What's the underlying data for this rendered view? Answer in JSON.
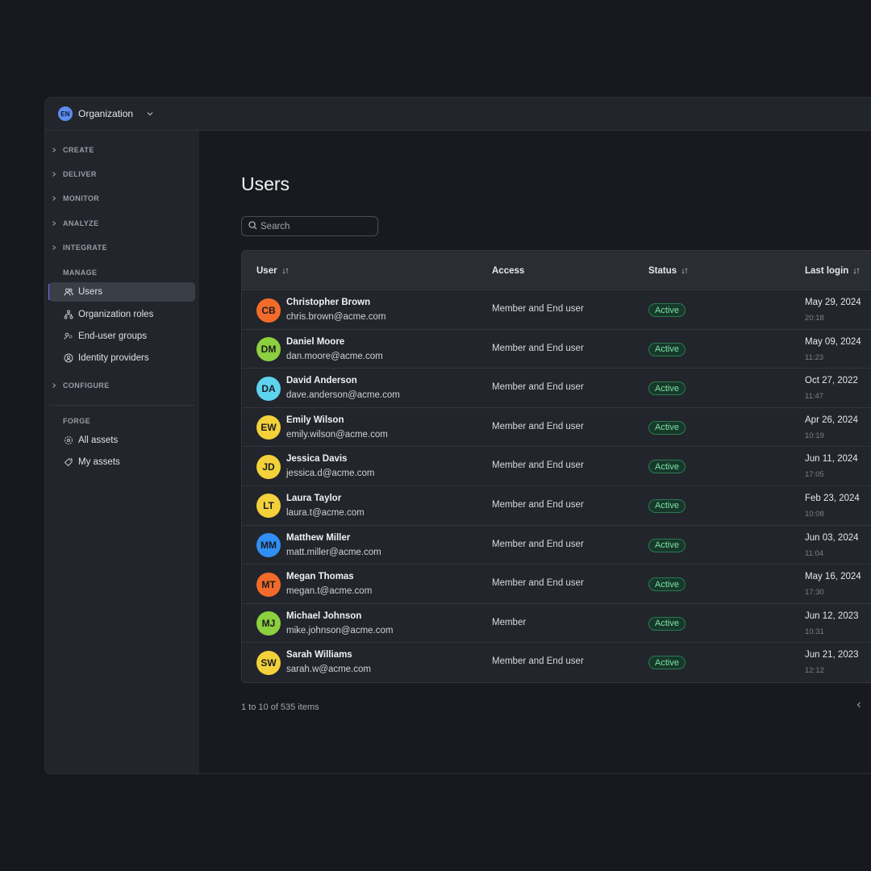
{
  "org": {
    "initials": "EN",
    "name": "Organization"
  },
  "sidebar": {
    "sections": [
      {
        "label": "CREATE"
      },
      {
        "label": "DELIVER"
      },
      {
        "label": "MONITOR"
      },
      {
        "label": "ANALYZE"
      },
      {
        "label": "INTEGRATE"
      }
    ],
    "manage_label": "MANAGE",
    "manage_items": [
      {
        "label": "Users",
        "icon": "users-icon",
        "active": true
      },
      {
        "label": "Organization roles",
        "icon": "hierarchy-icon"
      },
      {
        "label": "End-user groups",
        "icon": "user-group-icon"
      },
      {
        "label": "Identity providers",
        "icon": "identity-icon"
      }
    ],
    "configure_label": "CONFIGURE",
    "forge_label": "FORGE",
    "forge_items": [
      {
        "label": "All assets",
        "icon": "assets-icon"
      },
      {
        "label": "My assets",
        "icon": "tag-icon"
      }
    ]
  },
  "main": {
    "title": "Users",
    "search_placeholder": "Search",
    "columns": {
      "user": "User",
      "access": "Access",
      "status": "Status",
      "last_login": "Last login"
    },
    "rows": [
      {
        "initials": "CB",
        "color": "#f26b2a",
        "name": "Christopher Brown",
        "email": "chris.brown@acme.com",
        "access": "Member and End user",
        "status": "Active",
        "date": "May 29, 2024",
        "time": "20:18"
      },
      {
        "initials": "DM",
        "color": "#8ccf3f",
        "name": "Daniel Moore",
        "email": "dan.moore@acme.com",
        "access": "Member and End user",
        "status": "Active",
        "date": "May 09, 2024",
        "time": "11:23"
      },
      {
        "initials": "DA",
        "color": "#5ed3ee",
        "name": "David Anderson",
        "email": "dave.anderson@acme.com",
        "access": "Member and End user",
        "status": "Active",
        "date": "Oct 27, 2022",
        "time": "11:47"
      },
      {
        "initials": "EW",
        "color": "#f2d13a",
        "name": "Emily Wilson",
        "email": "emily.wilson@acme.com",
        "access": "Member and End user",
        "status": "Active",
        "date": "Apr 26, 2024",
        "time": "10:19"
      },
      {
        "initials": "JD",
        "color": "#f2d13a",
        "name": "Jessica Davis",
        "email": "jessica.d@acme.com",
        "access": "Member and End user",
        "status": "Active",
        "date": "Jun 11, 2024",
        "time": "17:05"
      },
      {
        "initials": "LT",
        "color": "#f2d13a",
        "name": "Laura Taylor",
        "email": "laura.t@acme.com",
        "access": "Member and End user",
        "status": "Active",
        "date": "Feb 23, 2024",
        "time": "10:08"
      },
      {
        "initials": "MM",
        "color": "#2f8ff5",
        "name": "Matthew Miller",
        "email": "matt.miller@acme.com",
        "access": "Member and End user",
        "status": "Active",
        "date": "Jun 03, 2024",
        "time": "11:04"
      },
      {
        "initials": "MT",
        "color": "#f26b2a",
        "name": "Megan Thomas",
        "email": "megan.t@acme.com",
        "access": "Member and End user",
        "status": "Active",
        "date": "May 16, 2024",
        "time": "17:30"
      },
      {
        "initials": "MJ",
        "color": "#8ccf3f",
        "name": "Michael Johnson",
        "email": "mike.johnson@acme.com",
        "access": "Member",
        "status": "Active",
        "date": "Jun 12, 2023",
        "time": "10:31"
      },
      {
        "initials": "SW",
        "color": "#f2d13a",
        "name": "Sarah Williams",
        "email": "sarah.w@acme.com",
        "access": "Member and End user",
        "status": "Active",
        "date": "Jun 21, 2023",
        "time": "12:12"
      }
    ],
    "pagination": "1 to 10 of 535 items"
  }
}
